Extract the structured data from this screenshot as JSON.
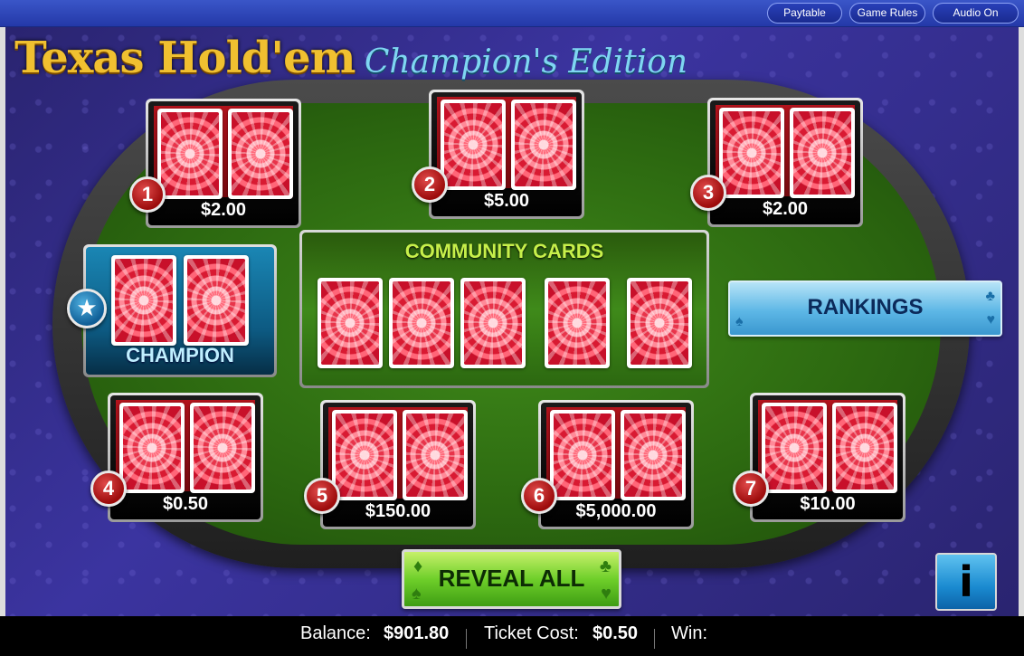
{
  "topbar": {
    "paytable": "Paytable",
    "game_rules": "Game Rules",
    "audio": "Audio On"
  },
  "title": {
    "main": "Texas Hold'em",
    "sub": "Champion's Edition"
  },
  "hands": [
    {
      "number": "1",
      "prize": "$2.00"
    },
    {
      "number": "2",
      "prize": "$5.00"
    },
    {
      "number": "3",
      "prize": "$2.00"
    },
    {
      "number": "4",
      "prize": "$0.50"
    },
    {
      "number": "5",
      "prize": "$150.00"
    },
    {
      "number": "6",
      "prize": "$5,000.00"
    },
    {
      "number": "7",
      "prize": "$10.00"
    }
  ],
  "champion": {
    "label": "CHAMPION",
    "badge_icon": "star-icon"
  },
  "community": {
    "title": "COMMUNITY CARDS",
    "card_count": 5
  },
  "buttons": {
    "rankings": "RANKINGS",
    "reveal_all": "REVEAL ALL",
    "info": "i"
  },
  "status": {
    "balance_label": "Balance:",
    "balance_value": "$901.80",
    "ticket_cost_label": "Ticket Cost:",
    "ticket_cost_value": "$0.50",
    "win_label": "Win:",
    "win_value": ""
  },
  "colors": {
    "topbar": "#2d45b8",
    "felt": "#3f8a1a",
    "badge_red": "#b31418",
    "card_back": "#e8344a",
    "champion_teal": "#1a86b4",
    "rankings_blue": "#5db7e6",
    "reveal_green": "#6fcf2a",
    "title_gold": "#f0c030",
    "title_cyan": "#7fd6f2"
  }
}
